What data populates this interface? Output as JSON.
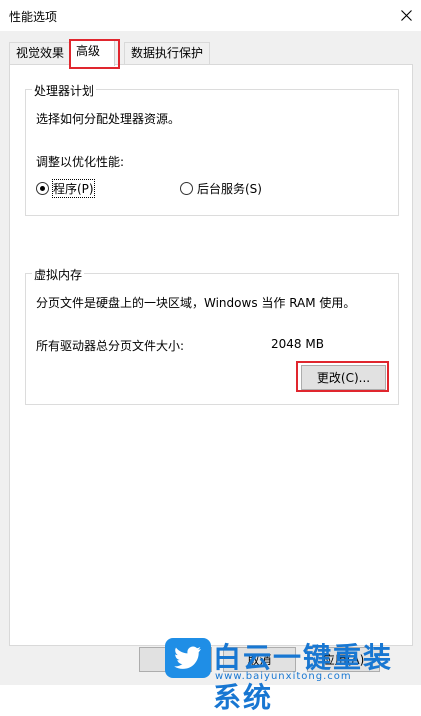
{
  "window": {
    "title": "性能选项",
    "close_glyph": "✕"
  },
  "tabs": [
    {
      "label": "视觉效果"
    },
    {
      "label": "高级"
    },
    {
      "label": "数据执行保护"
    }
  ],
  "processor": {
    "group_title": "处理器计划",
    "description": "选择如何分配处理器资源。",
    "adjust_label": "调整以优化性能:",
    "options": [
      {
        "label": "程序(P)",
        "checked": true
      },
      {
        "label": "后台服务(S)",
        "checked": false
      }
    ]
  },
  "virtual_memory": {
    "group_title": "虚拟内存",
    "description": "分页文件是硬盘上的一块区域，Windows 当作 RAM 使用。",
    "total_label": "所有驱动器总分页文件大小:",
    "total_value": "2048 MB",
    "change_button": "更改(C)..."
  },
  "footer": {
    "cancel_button": "取消",
    "apply_button": "应用(A)"
  },
  "watermark": {
    "title": "白云一键重装系统",
    "url": "www.baiyunxitong.com"
  },
  "colors": {
    "highlight": "#e0262e",
    "accent": "#1877d2"
  }
}
